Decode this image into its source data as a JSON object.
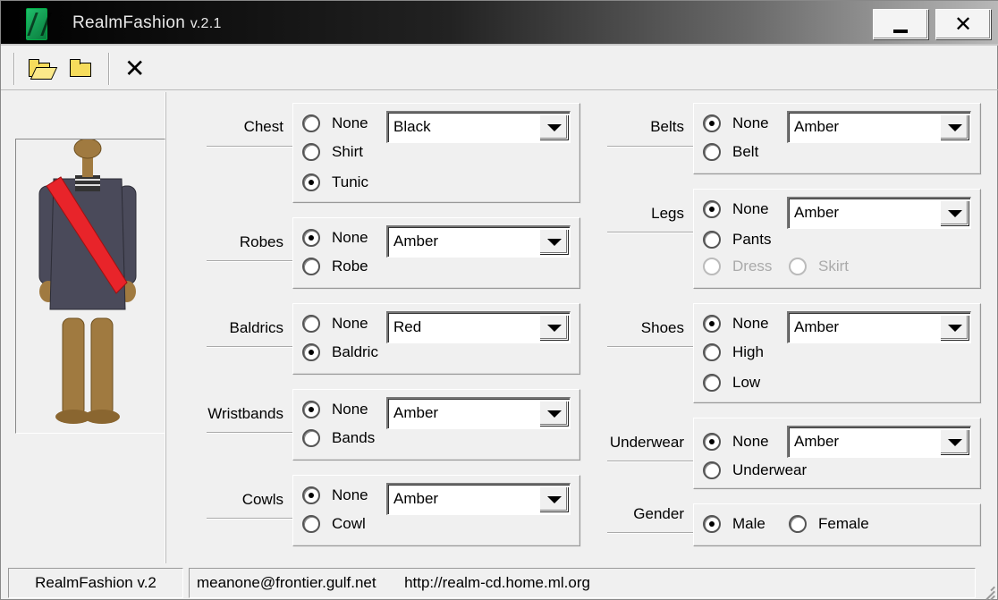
{
  "window": {
    "title": "RealmFashion",
    "version": "v.2.1"
  },
  "titlebar": {
    "min_label": "_",
    "close_label": "✕"
  },
  "toolbar": {
    "open_icon": "open-folder-icon",
    "folder_icon": "folder-icon",
    "delete_icon": "x-icon",
    "close_glyph": "✕"
  },
  "colors": {
    "title_start": "#000000",
    "title_end": "#b8b8b8",
    "sash": "#e8242a",
    "tunic": "#4a4a5a",
    "skin": "#a07a40"
  },
  "groups": {
    "chest": {
      "label": "Chest",
      "options": [
        "None",
        "Shirt",
        "Tunic"
      ],
      "selected": "Tunic",
      "color": "Black"
    },
    "robes": {
      "label": "Robes",
      "options": [
        "None",
        "Robe"
      ],
      "selected": "None",
      "color": "Amber"
    },
    "baldrics": {
      "label": "Baldrics",
      "options": [
        "None",
        "Baldric"
      ],
      "selected": "Baldric",
      "color": "Red"
    },
    "wristbands": {
      "label": "Wristbands",
      "options": [
        "None",
        "Bands"
      ],
      "selected": "None",
      "color": "Amber"
    },
    "cowls": {
      "label": "Cowls",
      "options": [
        "None",
        "Cowl"
      ],
      "selected": "None",
      "color": "Amber"
    },
    "belts": {
      "label": "Belts",
      "options": [
        "None",
        "Belt"
      ],
      "selected": "None",
      "color": "Amber"
    },
    "legs": {
      "label": "Legs",
      "options": [
        "None",
        "Pants",
        "Dress",
        "Skirt"
      ],
      "selected": "None",
      "color": "Amber",
      "disabled": [
        "Dress",
        "Skirt"
      ]
    },
    "shoes": {
      "label": "Shoes",
      "options": [
        "None",
        "High",
        "Low"
      ],
      "selected": "None",
      "color": "Amber"
    },
    "underwear": {
      "label": "Underwear",
      "options": [
        "None",
        "Underwear"
      ],
      "selected": "None",
      "color": "Amber"
    },
    "gender": {
      "label": "Gender",
      "options": [
        "Male",
        "Female"
      ],
      "selected": "Male"
    }
  },
  "status": {
    "app": "RealmFashion  v.2",
    "email": "meanone@frontier.gulf.net",
    "url": "http://realm-cd.home.ml.org"
  }
}
